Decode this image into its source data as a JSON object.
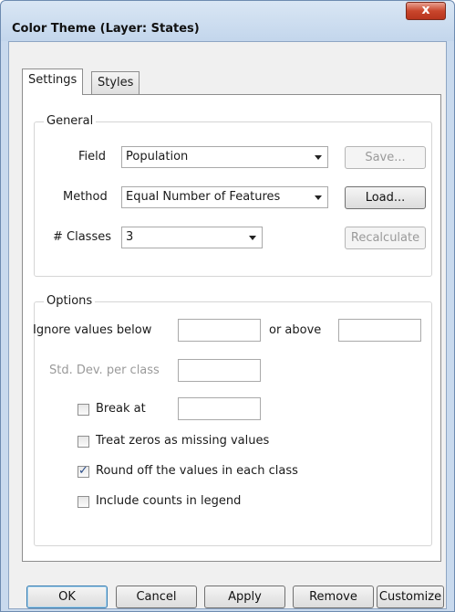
{
  "window": {
    "title": "Color Theme (Layer: States)",
    "close_glyph": "x"
  },
  "tabs": [
    {
      "label": "Settings",
      "active": true
    },
    {
      "label": "Styles",
      "active": false
    }
  ],
  "general": {
    "legend": "General",
    "field_label": "Field",
    "field_value": "Population",
    "method_label": "Method",
    "method_value": "Equal Number of Features",
    "classes_label": "# Classes",
    "classes_value": "3",
    "save_label": "Save...",
    "load_label": "Load...",
    "recalculate_label": "Recalculate"
  },
  "options": {
    "legend": "Options",
    "ignore_below_label": "Ignore values below",
    "ignore_below_value": "",
    "or_above_label": "or above",
    "or_above_value": "",
    "stddev_label": "Std. Dev. per class",
    "stddev_value": "",
    "break_at_label": "Break at",
    "break_at_checked": false,
    "break_at_value": "",
    "zeros_missing_label": "Treat zeros as missing values",
    "zeros_missing_checked": false,
    "round_off_label": "Round off the values in each class",
    "round_off_checked": true,
    "counts_legend_label": "Include counts in legend",
    "counts_legend_checked": false,
    "check_glyph": "✓"
  },
  "buttons": {
    "ok": "OK",
    "cancel": "Cancel",
    "apply": "Apply",
    "remove": "Remove",
    "customize": "Customize"
  }
}
